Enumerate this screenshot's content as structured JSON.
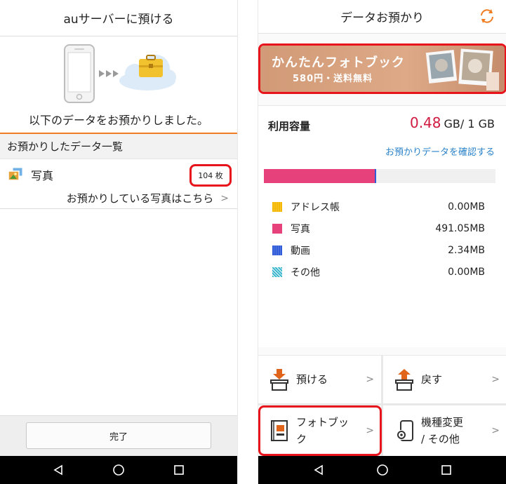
{
  "left": {
    "header_title": "auサーバーに預ける",
    "message": "以下のデータをお預かりしました。",
    "section_title": "お預かりしたデータ一覧",
    "photo_label": "写真",
    "photo_count": "104 枚",
    "view_link": "お預かりしている写真はこちら",
    "chevron": ">",
    "done_button": "完了"
  },
  "right": {
    "header_title": "データお預かり",
    "banner_title": "かんたんフォトブック",
    "banner_sub": "580円・送料無料",
    "usage_label": "利用容量",
    "usage_used": "0.48",
    "usage_total": "GB/ 1 GB",
    "usage_fraction": 0.48,
    "confirm_link": "お預かりデータを確認する",
    "legend": [
      {
        "name": "アドレス帳",
        "size": "0.00MB",
        "color": "#f5b800"
      },
      {
        "name": "写真",
        "size": "491.05MB",
        "color": "#e6417a"
      },
      {
        "name": "動画",
        "size": "2.34MB",
        "color": "#2f5bd8"
      },
      {
        "name": "その他",
        "size": "0.00MB",
        "color": "#3bb7d0"
      }
    ],
    "tiles": {
      "deposit": "預ける",
      "restore": "戻す",
      "photobook_line1": "フォトブッ",
      "photobook_line2": "ク",
      "change_line1": "機種変更",
      "change_line2": "/ その他",
      "chevron": ">"
    }
  },
  "colors": {
    "accent_orange": "#f07d23",
    "highlight_red": "#e8141c",
    "link_blue": "#2a82c9",
    "used_red": "#d01a40"
  }
}
